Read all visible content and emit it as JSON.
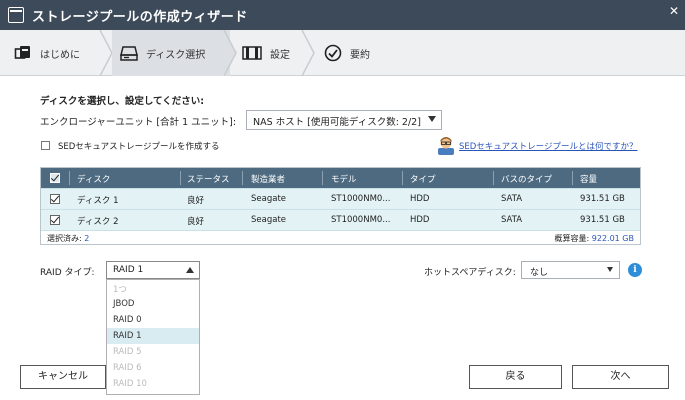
{
  "window": {
    "title": "ストレージプールの作成ウィザード",
    "close_glyph": "✕"
  },
  "steps": [
    {
      "label": "はじめに",
      "icon": "cube-stack-icon"
    },
    {
      "label": "ディスク選択",
      "icon": "disk-drive-icon",
      "active": true
    },
    {
      "label": "設定",
      "icon": "config-icon"
    },
    {
      "label": "要約",
      "icon": "checkmark-circle-icon"
    }
  ],
  "heading": "ディスクを選択し、設定してください:",
  "enclosure": {
    "label": "エンクロージャーユニット [合計 1 ユニット]:",
    "value": "NAS ホスト [使用可能ディスク数: 2/2]"
  },
  "sed": {
    "checkbox_label": "SEDセキュアストレージプールを作成する",
    "link": "SEDセキュアストレージプールとは何ですか？"
  },
  "table": {
    "headers": [
      "ディスク",
      "ステータス",
      "製造業者",
      "モデル",
      "タイプ",
      "バスのタイプ",
      "容量"
    ],
    "rows": [
      [
        "ディスク 1",
        "良好",
        "Seagate",
        "ST1000NM0...",
        "HDD",
        "SATA",
        "931.51 GB"
      ],
      [
        "ディスク 2",
        "良好",
        "Seagate",
        "ST1000NM0...",
        "HDD",
        "SATA",
        "931.51 GB"
      ]
    ],
    "footer": {
      "selected_label": "選択済み:",
      "selected_count": "2",
      "capacity_label": "概算容量:",
      "capacity_value": "922.01 GB"
    }
  },
  "raid": {
    "label": "RAID タイプ:",
    "value": "RAID 1",
    "options": [
      {
        "label": "1つ",
        "enabled": false
      },
      {
        "label": "JBOD",
        "enabled": true
      },
      {
        "label": "RAID 0",
        "enabled": true
      },
      {
        "label": "RAID 1",
        "enabled": true,
        "selected": true
      },
      {
        "label": "RAID 5",
        "enabled": false
      },
      {
        "label": "RAID 6",
        "enabled": false
      },
      {
        "label": "RAID 10",
        "enabled": false
      }
    ]
  },
  "hot_spare": {
    "label": "ホットスペアディスク:",
    "value": "なし"
  },
  "info_glyph": "i",
  "buttons": {
    "cancel": "キャンセル",
    "back": "戻る",
    "next": "次へ"
  },
  "colors": {
    "titlebar": "#3c4a5a",
    "table_header": "#4d6a80",
    "row_bg": "#e3f2f5",
    "link": "#2a55b8",
    "info": "#2f8ed8"
  }
}
